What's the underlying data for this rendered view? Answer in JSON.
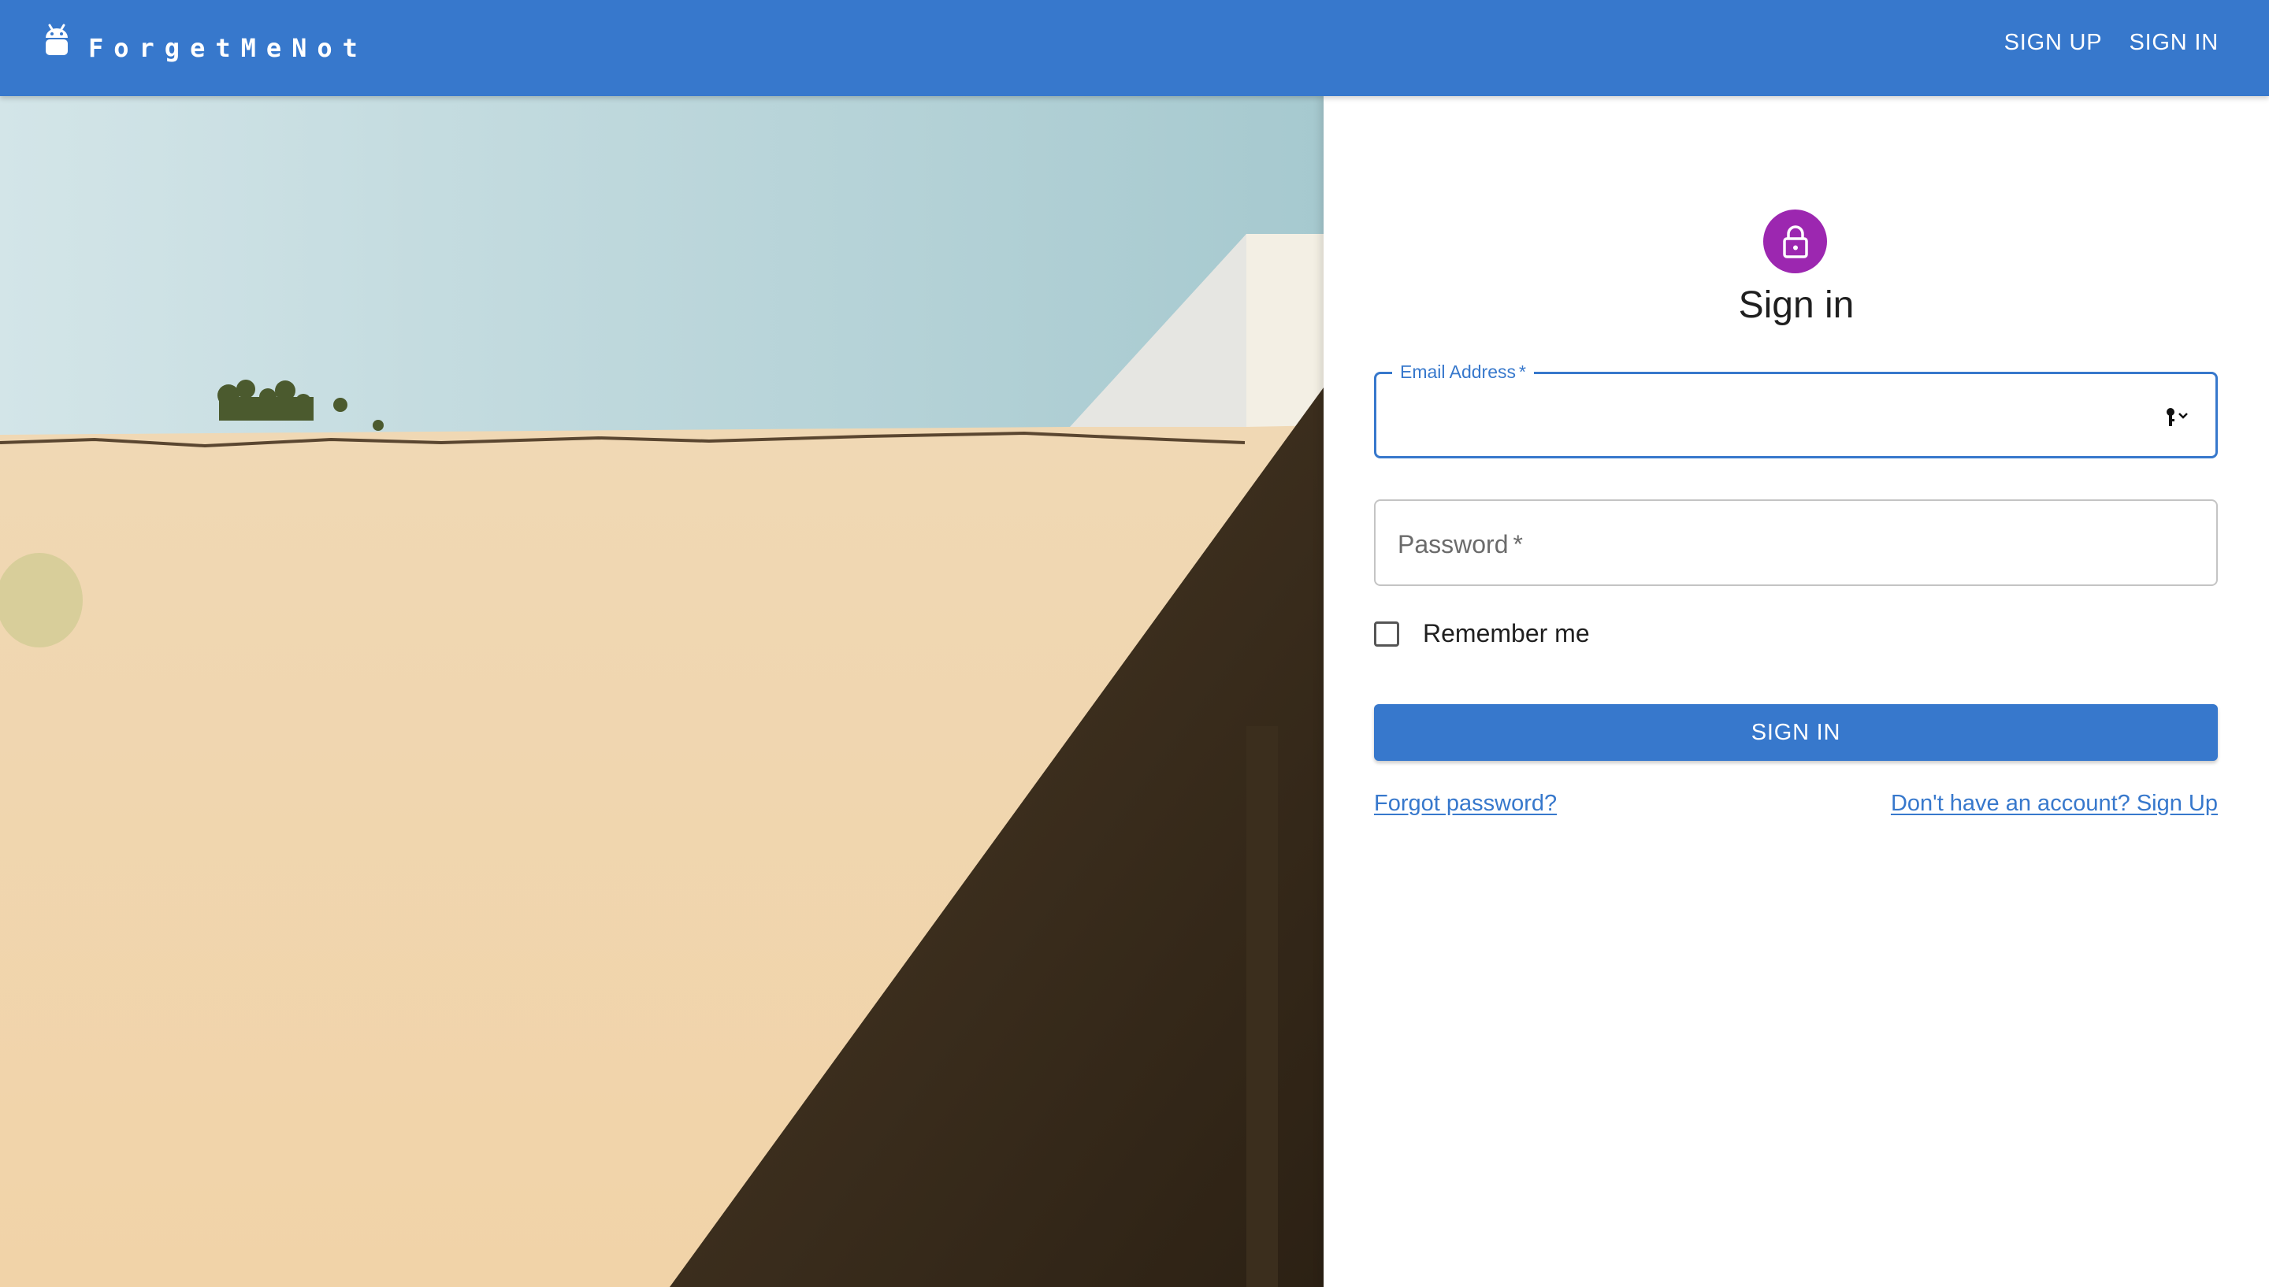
{
  "app": {
    "brand": "ForgetMeNot"
  },
  "header": {
    "nav": [
      {
        "label": "SIGN UP"
      },
      {
        "label": "SIGN IN"
      }
    ]
  },
  "form": {
    "title": "Sign in",
    "email": {
      "label": "Email Address",
      "required_mark": "*",
      "value": ""
    },
    "password": {
      "placeholder": "Password",
      "required_mark": "*"
    },
    "remember": {
      "label": "Remember me",
      "checked": false
    },
    "submit_label": "SIGN IN",
    "forgot_link": "Forgot password?",
    "signup_link": "Don't have an account? Sign Up"
  },
  "colors": {
    "primary": "#3778cc",
    "avatar": "#9c27b0"
  },
  "icons": {
    "brand": "android-icon",
    "avatar": "lock-icon",
    "autofill": "key-icon"
  }
}
